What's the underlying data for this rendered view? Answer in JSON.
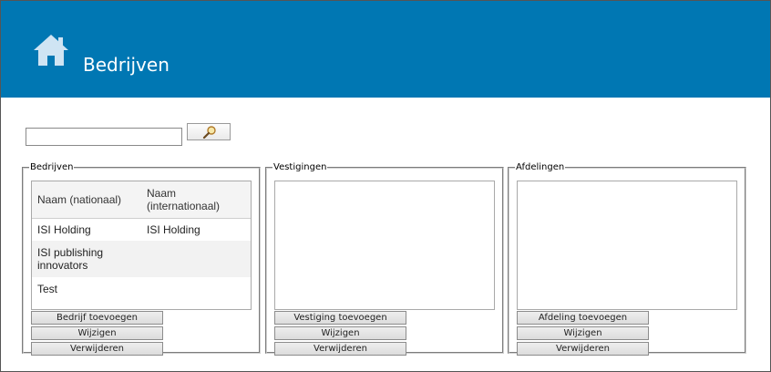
{
  "header": {
    "title": "Bedrijven",
    "icon": "home-icon",
    "background": "#0077b3"
  },
  "search": {
    "value": "",
    "button_icon": "magnifier-icon"
  },
  "companies": {
    "legend": "Bedrijven",
    "columns": [
      "Naam (nationaal)",
      "Naam (internationaal)"
    ],
    "rows": [
      [
        "ISI Holding",
        "ISI Holding"
      ],
      [
        "ISI publishing innovators",
        ""
      ],
      [
        "Test",
        ""
      ]
    ],
    "buttons": {
      "add": "Bedrijf toevoegen",
      "edit": "Wijzigen",
      "delete": "Verwijderen"
    }
  },
  "locations": {
    "legend": "Vestigingen",
    "buttons": {
      "add": "Vestiging toevoegen",
      "edit": "Wijzigen",
      "delete": "Verwijderen"
    }
  },
  "departments": {
    "legend": "Afdelingen",
    "buttons": {
      "add": "Afdeling toevoegen",
      "edit": "Wijzigen",
      "delete": "Verwijderen"
    }
  }
}
